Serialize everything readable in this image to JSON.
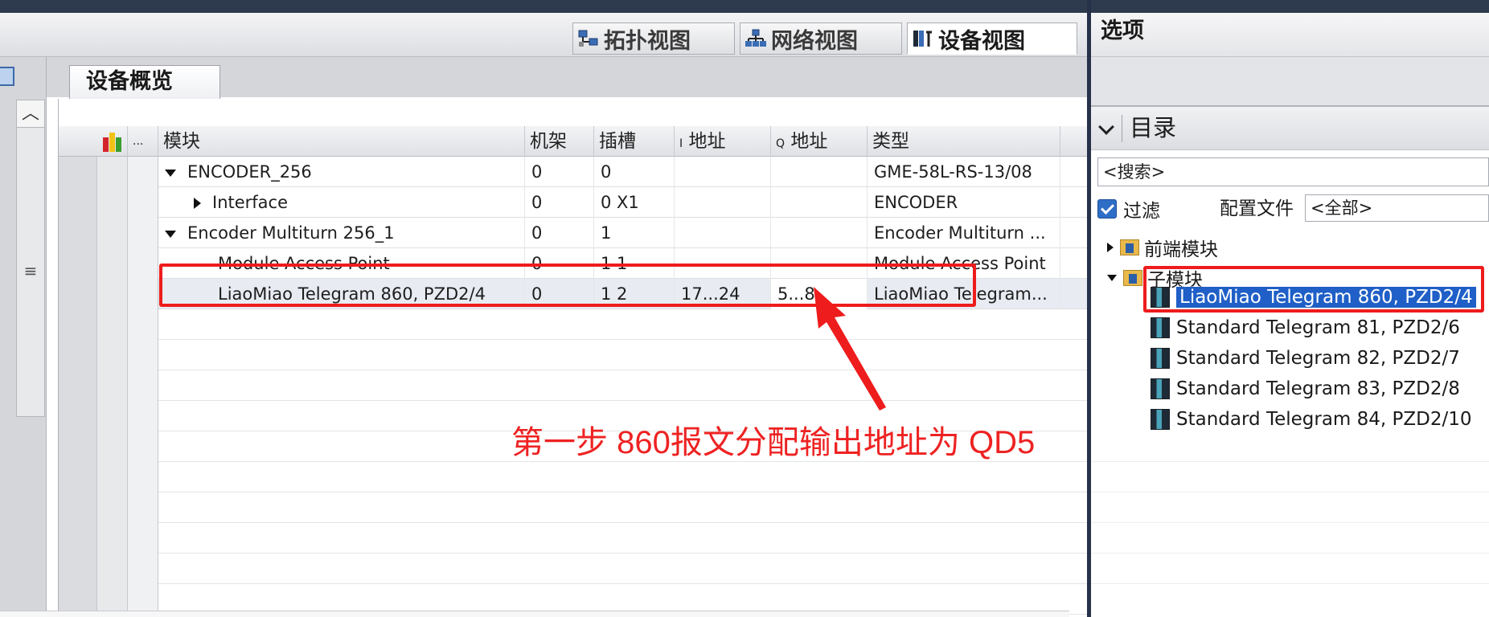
{
  "view_tabs": [
    {
      "label": "拓扑视图",
      "active": false
    },
    {
      "label": "网络视图",
      "active": false
    },
    {
      "label": "设备视图",
      "active": true
    }
  ],
  "device_overview_tab": "设备概览",
  "table": {
    "headers": {
      "module": "模块",
      "rack": "机架",
      "slot": "插槽",
      "i_prefix": "I",
      "i_addr": "地址",
      "q_prefix": "Q",
      "q_addr": "地址",
      "type": "类型",
      "ellipsis": "..."
    },
    "rows": [
      {
        "indent": 0,
        "expand": "down",
        "module": "ENCODER_256",
        "rack": "0",
        "slot": "0",
        "i_addr": "",
        "q_addr": "",
        "type": "GME-58L-RS-13/08"
      },
      {
        "indent": 1,
        "expand": "right",
        "module": "Interface",
        "rack": "0",
        "slot": "0 X1",
        "i_addr": "",
        "q_addr": "",
        "type": "ENCODER"
      },
      {
        "indent": 0,
        "expand": "down",
        "module": "Encoder Multiturn 256_1",
        "rack": "0",
        "slot": "1",
        "i_addr": "",
        "q_addr": "",
        "type": "Encoder Multiturn ..."
      },
      {
        "indent": 1,
        "expand": "none",
        "module": "Module Access Point",
        "rack": "0",
        "slot": "1 1",
        "i_addr": "",
        "q_addr": "",
        "type": "Module Access Point"
      },
      {
        "indent": 1,
        "expand": "none",
        "module": "LiaoMiao Telegram 860, PZD2/4",
        "rack": "0",
        "slot": "1 2",
        "i_addr": "17...24",
        "q_addr": "5...8",
        "type": "LiaoMiao Telegram..."
      }
    ]
  },
  "annotation": "第一步 860报文分配输出地址为 QD5",
  "options_panel": {
    "title": "选项",
    "catalog_title": "目录",
    "search_placeholder": "<搜索>",
    "filter_label": "过滤",
    "filter_checked": true,
    "profile_label": "配置文件",
    "profile_value": "<全部>",
    "tree": {
      "front_modules": "前端模块",
      "submodules": "子模块",
      "items": [
        "LiaoMiao Telegram 860, PZD2/4",
        "Standard Telegram 81, PZD2/6",
        "Standard Telegram 82, PZD2/7",
        "Standard Telegram 83, PZD2/8",
        "Standard Telegram 84, PZD2/10"
      ]
    }
  },
  "colors": {
    "highlight_red": "#ee1c1c",
    "selection_blue": "#1f5fc7",
    "titlebar": "#2e3a4e"
  }
}
